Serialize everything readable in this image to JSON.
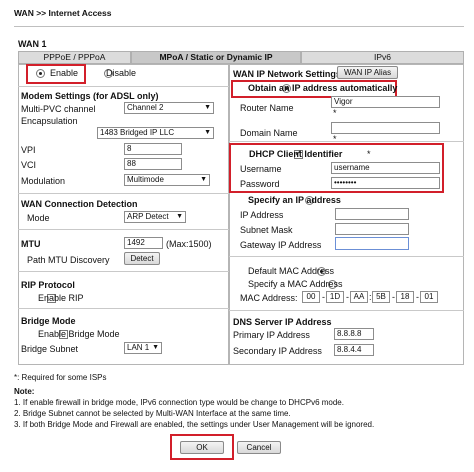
{
  "breadcrumb": "WAN >> Internet Access",
  "section": "WAN 1",
  "tabs": [
    "PPPoE / PPPoA",
    "MPoA / Static or Dynamic IP",
    "IPv6"
  ],
  "enable": {
    "enable_label": "Enable",
    "disable_label": "Disable"
  },
  "modem": {
    "title": "Modem Settings (for ADSL only)",
    "pvc_label": "Multi-PVC channel",
    "pvc_value": "Channel 2",
    "encap_label": "Encapsulation",
    "encap_value": "1483 Bridged IP LLC",
    "vpi_label": "VPI",
    "vpi_value": "8",
    "vci_label": "VCI",
    "vci_value": "88",
    "mod_label": "Modulation",
    "mod_value": "Multimode"
  },
  "wcd": {
    "title": "WAN Connection Detection",
    "mode_label": "Mode",
    "mode_value": "ARP Detect"
  },
  "mtu": {
    "title": "MTU",
    "value": "1492",
    "max": "(Max:1500)",
    "discovery_label": "Path MTU Discovery",
    "detect_label": "Detect"
  },
  "rip": {
    "title": "RIP Protocol",
    "enable_label": "Enable RIP"
  },
  "bridge": {
    "title": "Bridge Mode",
    "enable_label": "Enable Bridge Mode",
    "subnet_label": "Bridge Subnet",
    "subnet_value": "LAN 1"
  },
  "wan_ip": {
    "tab1": "WAN IP Network Settings",
    "tab2": "WAN IP Alias",
    "obtain_label": "Obtain an IP address automatically",
    "router_name_label": "Router Name",
    "router_name_value": "Vigor",
    "router_name_note": "*",
    "domain_label": "Domain Name",
    "domain_note": "*",
    "dhcp_label": "DHCP Client Identifier",
    "dhcp_note": "*",
    "username_label": "Username",
    "username_value": "username",
    "password_label": "Password",
    "password_value": "••••••••",
    "specify_label": "Specify an IP address",
    "ip_label": "IP Address",
    "mask_label": "Subnet Mask",
    "gateway_label": "Gateway IP Address",
    "default_mac_label": "Default MAC Address",
    "specify_mac_label": "Specify a MAC Address",
    "mac_label": "MAC Address:",
    "mac_parts": [
      "00",
      "1D",
      "AA",
      "5B",
      "18",
      "01"
    ]
  },
  "dns": {
    "title": "DNS Server IP Address",
    "primary_label": "Primary IP Address",
    "primary_value": "8.8.8.8",
    "secondary_label": "Secondary IP Address",
    "secondary_value": "8.8.4.4"
  },
  "notes": {
    "required": "*: Required for some ISPs",
    "title": "Note:",
    "n1": "1. If enable firewall in bridge mode, IPv6 connection type would be change to DHCPv6 mode.",
    "n2": "2. Bridge Subnet cannot be selected by Multi-WAN Interface at the same time.",
    "n3": "3. If both Bridge Mode and Firewall are enabled, the settings under User Management will be ignored."
  },
  "buttons": {
    "ok": "OK",
    "cancel": "Cancel"
  },
  "colors": {
    "highlight": "#d21f2a",
    "tab_bg": "#dcdcdc",
    "border": "#b5b5b5"
  }
}
